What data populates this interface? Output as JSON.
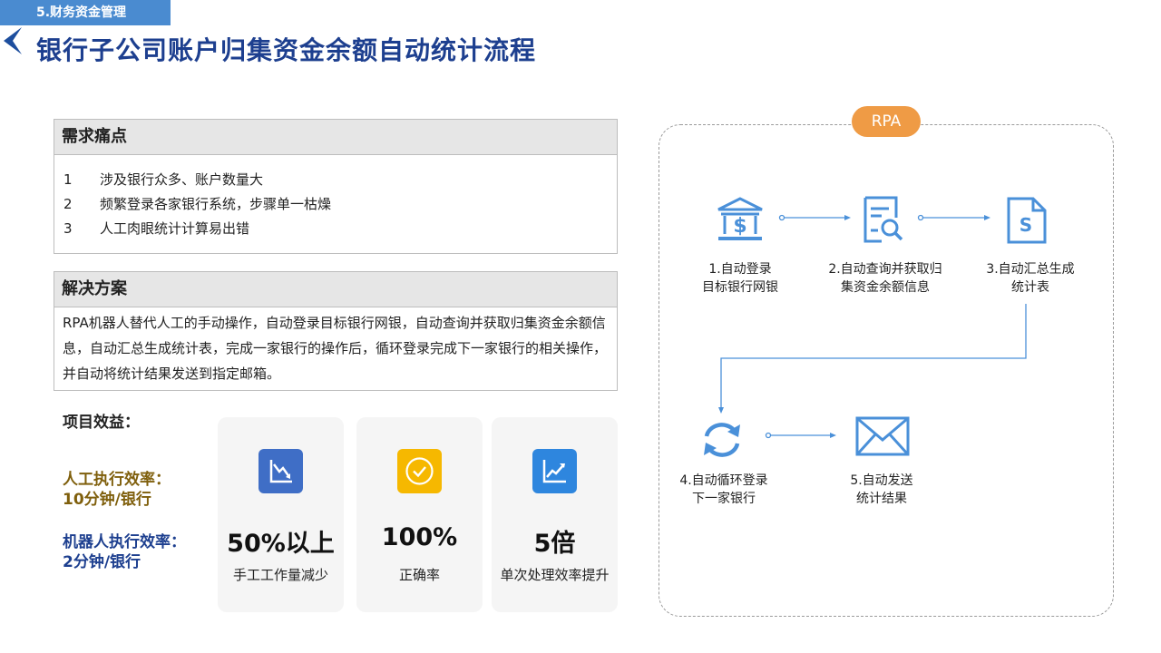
{
  "section_tag": "5.财务资金管理",
  "title": "银行子公司账户归集资金余额自动统计流程",
  "pain_points": {
    "heading": "需求痛点",
    "items": [
      {
        "num": "1",
        "text": "涉及银行众多、账户数量大"
      },
      {
        "num": "2",
        "text": "频繁登录各家银行系统，步骤单一枯燥"
      },
      {
        "num": "3",
        "text": "人工肉眼统计计算易出错"
      }
    ]
  },
  "solution": {
    "heading": "解决方案",
    "text": "RPA机器人替代人工的手动操作，自动登录目标银行网银，自动查询并获取归集资金余额信息，自动汇总生成统计表，完成一家银行的操作后，循环登录完成下一家银行的相关操作，并自动将统计结果发送到指定邮箱。"
  },
  "benefits": {
    "heading": "项目效益：",
    "manual_label": "人工执行效率：",
    "manual_value": "10分钟/银行",
    "robot_label": "机器人执行效率：",
    "robot_value": "2分钟/银行",
    "cards": [
      {
        "value": "50%以上",
        "label": "手工工作量减少",
        "icon": "chart-down-icon",
        "color": "#3f6ec6"
      },
      {
        "value": "100%",
        "label": "正确率",
        "icon": "check-circle-icon",
        "color": "#f6b800"
      },
      {
        "value": "5倍",
        "label": "单次处理效率提升",
        "icon": "chart-up-icon",
        "color": "#2e86de"
      }
    ]
  },
  "rpa": {
    "badge": "RPA",
    "steps": [
      {
        "line1": "1.自动登录",
        "line2": "目标银行网银",
        "icon": "bank-icon"
      },
      {
        "line1": "2.自动查询并获取归",
        "line2": "集资金余额信息",
        "icon": "document-search-icon"
      },
      {
        "line1": "3.自动汇总生成",
        "line2": "统计表",
        "icon": "dollar-document-icon"
      },
      {
        "line1": "4.自动循环登录",
        "line2": "下一家银行",
        "icon": "refresh-icon"
      },
      {
        "line1": "5.自动发送",
        "line2": "统计结果",
        "icon": "mail-icon"
      }
    ]
  },
  "colors": {
    "brand_blue": "#1d3f8f",
    "icon_blue": "#4a90d9",
    "accent_orange": "#ef9b45"
  }
}
